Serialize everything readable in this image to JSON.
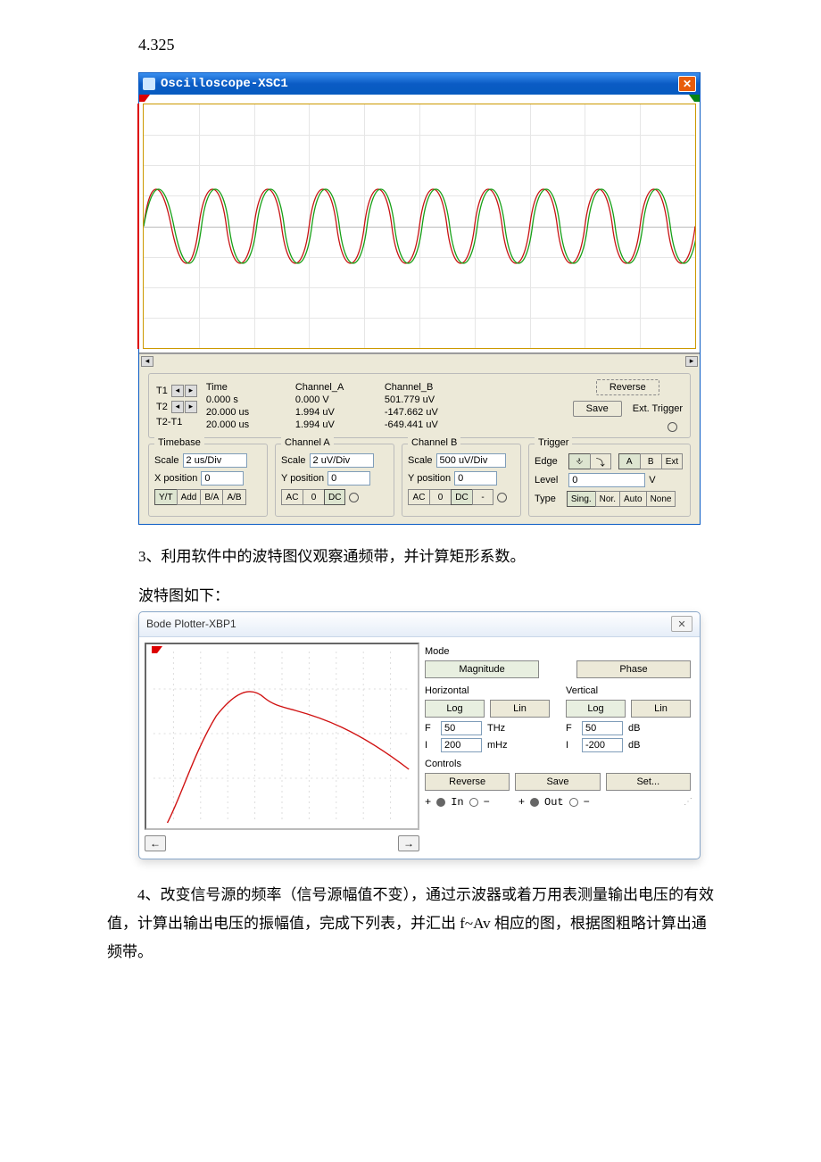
{
  "top_number": "4.325",
  "oscilloscope": {
    "title": "Oscilloscope-XSC1",
    "cursors": {
      "headers": {
        "time": "Time",
        "cha": "Channel_A",
        "chb": "Channel_B"
      },
      "t1": {
        "label": "T1",
        "time": "0.000 s",
        "cha": "0.000 V",
        "chb": "501.779 uV"
      },
      "t2": {
        "label": "T2",
        "time": "20.000 us",
        "cha": "1.994 uV",
        "chb": "-147.662 uV"
      },
      "diff": {
        "label": "T2-T1",
        "time": "20.000 us",
        "cha": "1.994 uV",
        "chb": "-649.441 uV"
      }
    },
    "buttons": {
      "reverse": "Reverse",
      "save": "Save",
      "ext_trigger": "Ext. Trigger"
    },
    "timebase": {
      "legend": "Timebase",
      "scale_label": "Scale",
      "scale_value": "2 us/Div",
      "xpos_label": "X position",
      "xpos_value": "0",
      "modes": [
        "Y/T",
        "Add",
        "B/A",
        "A/B"
      ]
    },
    "channel_a": {
      "legend": "Channel A",
      "scale_label": "Scale",
      "scale_value": "2 uV/Div",
      "ypos_label": "Y position",
      "ypos_value": "0",
      "couplings": [
        "AC",
        "0",
        "DC"
      ]
    },
    "channel_b": {
      "legend": "Channel B",
      "scale_label": "Scale",
      "scale_value": "500 uV/Div",
      "ypos_label": "Y position",
      "ypos_value": "0",
      "couplings": [
        "AC",
        "0",
        "DC",
        "-"
      ]
    },
    "trigger": {
      "legend": "Trigger",
      "edge_label": "Edge",
      "edge_opts": [
        "A",
        "B",
        "Ext"
      ],
      "level_label": "Level",
      "level_value": "0",
      "level_unit": "V",
      "type_label": "Type",
      "type_opts": [
        "Sing.",
        "Nor.",
        "Auto",
        "None"
      ]
    }
  },
  "text_q3": "3、利用软件中的波特图仪观察通频带，并计算矩形系数。",
  "text_bode_intro": "波特图如下：",
  "bode": {
    "title": "Bode Plotter-XBP1",
    "mode_label": "Mode",
    "mode_tabs": {
      "magnitude": "Magnitude",
      "phase": "Phase"
    },
    "horizontal_label": "Horizontal",
    "vertical_label": "Vertical",
    "scale_tabs": {
      "log": "Log",
      "lin": "Lin"
    },
    "horiz": {
      "f_label": "F",
      "f_val": "50",
      "f_unit": "THz",
      "i_label": "I",
      "i_val": "200",
      "i_unit": "mHz"
    },
    "vert": {
      "f_label": "F",
      "f_val": "50",
      "f_unit": "dB",
      "i_label": "I",
      "i_val": "-200",
      "i_unit": "dB"
    },
    "controls_label": "Controls",
    "buttons": {
      "reverse": "Reverse",
      "save": "Save",
      "set": "Set..."
    },
    "io": {
      "in": "In",
      "out": "Out"
    }
  },
  "text_q4": "4、改变信号源的频率（信号源幅值不变），通过示波器或着万用表测量输出电压的有效值，计算出输出电压的振幅值，完成下列表，并汇出 f~Av 相应的图，根据图粗略计算出通频带。"
}
